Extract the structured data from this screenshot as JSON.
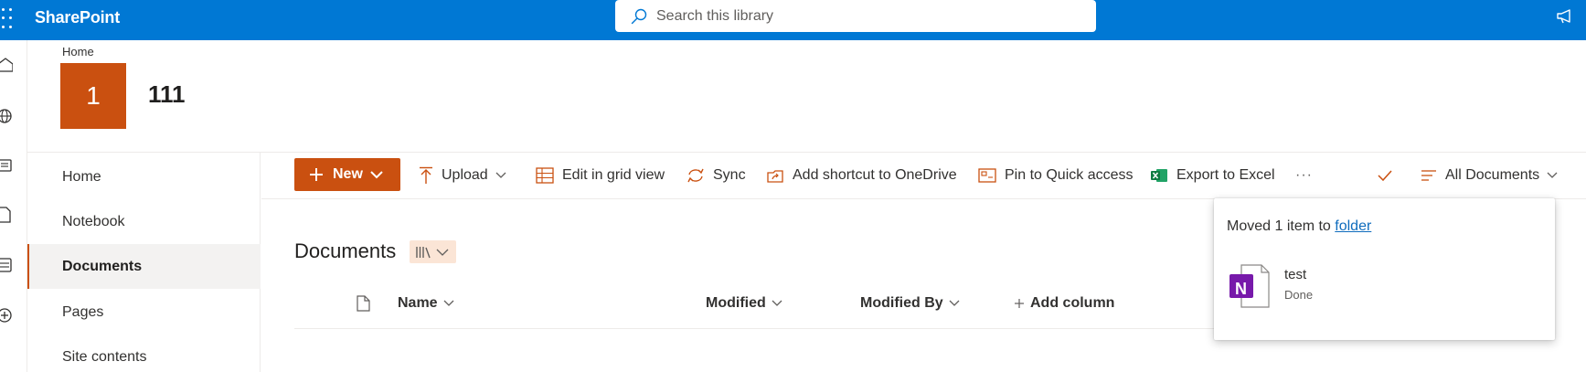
{
  "suitebar": {
    "brand": "SharePoint",
    "search_placeholder": "Search this library"
  },
  "site": {
    "breadcrumb": "Home",
    "logo_text": "1",
    "title": "111",
    "logo_color": "#ca5010"
  },
  "rail": {
    "icons": [
      "home-icon",
      "globe-icon",
      "news-icon",
      "files-icon",
      "lists-icon",
      "create-icon"
    ]
  },
  "leftnav": {
    "items": [
      {
        "label": "Home",
        "selected": false
      },
      {
        "label": "Notebook",
        "selected": false
      },
      {
        "label": "Documents",
        "selected": true
      },
      {
        "label": "Pages",
        "selected": false
      },
      {
        "label": "Site contents",
        "selected": false
      }
    ]
  },
  "commandbar": {
    "new_label": "New",
    "upload_label": "Upload",
    "grid_label": "Edit in grid view",
    "sync_label": "Sync",
    "shortcut_label": "Add shortcut to OneDrive",
    "pin_label": "Pin to Quick access",
    "excel_label": "Export to Excel",
    "more_label": "···",
    "view_label": "All Documents"
  },
  "library": {
    "title": "Documents",
    "columns": {
      "name": "Name",
      "modified": "Modified",
      "modified_by": "Modified By",
      "add_column": "Add column"
    }
  },
  "toast": {
    "message_prefix": "Moved 1 item to ",
    "link_text": "folder",
    "file_name": "test",
    "status": "Done",
    "file_icon_letter": "N"
  },
  "colors": {
    "suitebar": "#0078d4",
    "accent": "#ca5010",
    "onenote": "#7719aa",
    "excel": "#107c41"
  }
}
